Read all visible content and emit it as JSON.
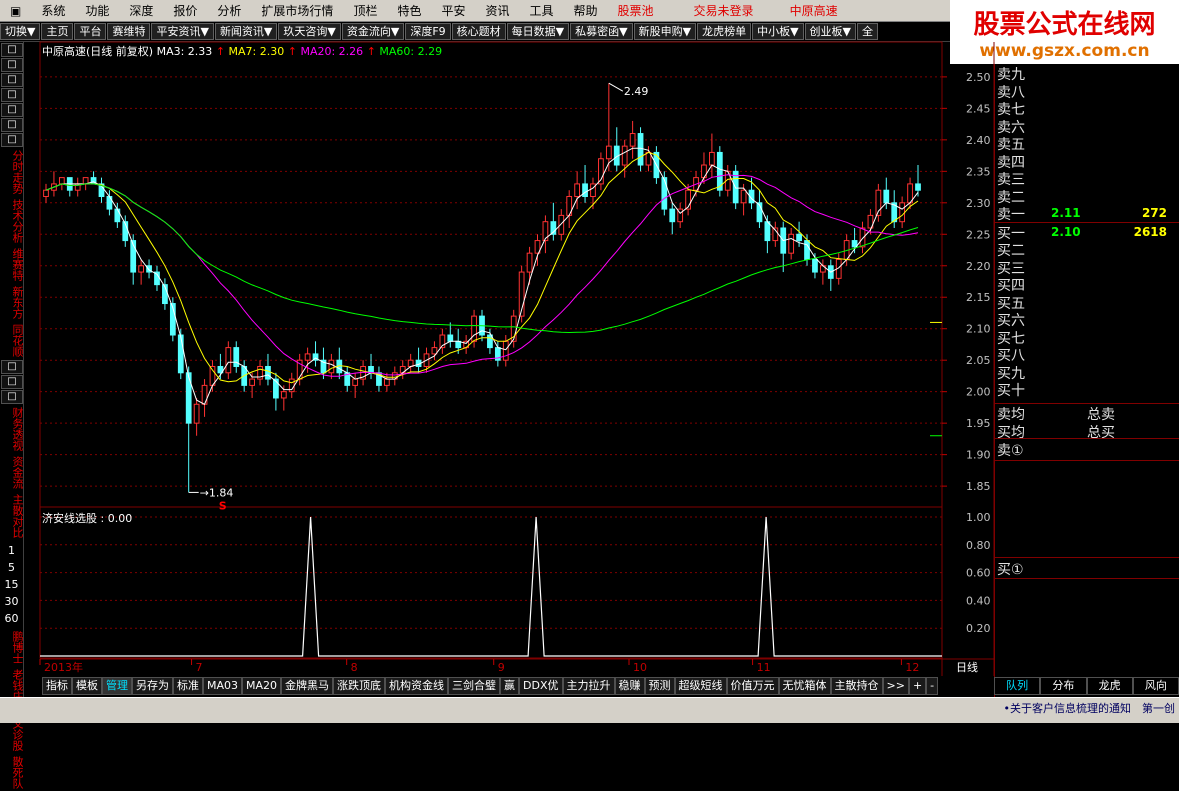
{
  "menu": [
    "系统",
    "功能",
    "深度",
    "报价",
    "分析",
    "扩展市场行情",
    "顶栏",
    "特色",
    "平安",
    "资讯",
    "工具",
    "帮助"
  ],
  "menu_highlight": "股票池",
  "login_status": "交易未登录",
  "stock_name": "中原高速",
  "banner": {
    "line1": "股票公式在线网",
    "line2": "www.gszx.com.cn"
  },
  "toolbar": [
    "切换▼",
    "主页",
    "平台",
    "赛维特",
    "平安资讯▼",
    "新闻资讯▼",
    "玖天咨询▼",
    "资金流向▼",
    "深度F9",
    "核心题材",
    "每日数据▼",
    "私募密函▼",
    "新股申购▼",
    "龙虎榜单",
    "中小板▼",
    "创业板▼",
    "全"
  ],
  "sidebar_text": [
    "分时走势",
    "技术分析",
    "维赛特",
    "新东方",
    "同花顺",
    "财务透视",
    "资金流",
    "主散对比",
    "鹏博士",
    "老钱庄",
    "牛叉诊股",
    "散死队"
  ],
  "sidebar_nums": [
    "1",
    "5",
    "15",
    "30",
    "60"
  ],
  "chart_title": {
    "name": "中原高速(日线 前复权)",
    "ma3": "MA3: 2.33",
    "ma7": "MA7: 2.30",
    "ma20": "MA20: 2.26",
    "ma60": "MA60: 2.29"
  },
  "sub_title": "济安线选股 : 0.00",
  "price_axis": [
    "2.50",
    "2.45",
    "2.40",
    "2.35",
    "2.30",
    "2.25",
    "2.20",
    "2.15",
    "2.10",
    "2.05",
    "2.00",
    "1.95",
    "1.90",
    "1.85"
  ],
  "sub_axis": [
    "1.00",
    "0.80",
    "0.60",
    "0.40",
    "0.20"
  ],
  "time_axis": [
    {
      "label": "2013年"
    },
    {
      "label": "7"
    },
    {
      "label": "8"
    },
    {
      "label": "9"
    },
    {
      "label": "10"
    },
    {
      "label": "11"
    },
    {
      "label": "12"
    }
  ],
  "period_label": "日线",
  "annotations": {
    "high": "2.49",
    "low": "1.84",
    "marker": "S"
  },
  "orderbook": {
    "sells": [
      "卖九",
      "卖八",
      "卖七",
      "卖六",
      "卖五",
      "卖四",
      "卖三",
      "卖二",
      "卖一"
    ],
    "sell1_price": "2.11",
    "sell1_vol": "272",
    "buys": [
      "买一",
      "买二",
      "买三",
      "买四",
      "买五",
      "买六",
      "买七",
      "买八",
      "买九",
      "买十"
    ],
    "buy1_price": "2.10",
    "buy1_vol": "2618",
    "avg_sell": "卖均",
    "avg_buy": "买均",
    "total_sell": "总卖",
    "total_buy": "总买",
    "sell_circle": "卖①",
    "buy_circle": "买①"
  },
  "bottom_tabs": [
    "指标",
    "模板",
    "管理",
    "另存为",
    "标准",
    "MA03",
    "MA20",
    "金牌黑马",
    "涨跌顶底",
    "机构资金线",
    "三剑合璧",
    "赢",
    "DDX优",
    "主力拉升",
    "稳赚",
    "预测",
    "超级短线",
    "价值万元",
    "无忧箱体",
    "主散持仓",
    ">>",
    "+",
    "-"
  ],
  "right_tabs": [
    "队列",
    "分布",
    "龙虎",
    "风向"
  ],
  "news": "•关于客户信息梳理的通知　第一创",
  "chart_data": {
    "type": "candlestick",
    "title": "中原高速(日线 前复权)",
    "ylim": [
      1.82,
      2.53
    ],
    "max_label": 2.49,
    "min_label": 1.84,
    "series": [
      {
        "name": "MA3",
        "color": "#ffffff",
        "last": 2.33
      },
      {
        "name": "MA7",
        "color": "#ffff00",
        "last": 2.3
      },
      {
        "name": "MA20",
        "color": "#ff00ff",
        "last": 2.26
      },
      {
        "name": "MA60",
        "color": "#00ff00",
        "last": 2.29
      }
    ],
    "ohlc": [
      [
        2.31,
        2.33,
        2.3,
        2.32
      ],
      [
        2.32,
        2.35,
        2.31,
        2.33
      ],
      [
        2.33,
        2.34,
        2.32,
        2.34
      ],
      [
        2.34,
        2.34,
        2.31,
        2.32
      ],
      [
        2.32,
        2.34,
        2.31,
        2.33
      ],
      [
        2.33,
        2.34,
        2.32,
        2.34
      ],
      [
        2.34,
        2.35,
        2.33,
        2.33
      ],
      [
        2.33,
        2.34,
        2.3,
        2.31
      ],
      [
        2.31,
        2.32,
        2.28,
        2.29
      ],
      [
        2.29,
        2.3,
        2.26,
        2.27
      ],
      [
        2.27,
        2.28,
        2.23,
        2.24
      ],
      [
        2.24,
        2.25,
        2.17,
        2.19
      ],
      [
        2.19,
        2.21,
        2.17,
        2.2
      ],
      [
        2.2,
        2.21,
        2.18,
        2.19
      ],
      [
        2.19,
        2.2,
        2.16,
        2.17
      ],
      [
        2.17,
        2.18,
        2.13,
        2.14
      ],
      [
        2.14,
        2.15,
        2.08,
        2.09
      ],
      [
        2.09,
        2.1,
        2.02,
        2.03
      ],
      [
        2.03,
        2.04,
        1.84,
        1.95
      ],
      [
        1.95,
        1.99,
        1.93,
        1.98
      ],
      [
        1.98,
        2.02,
        1.96,
        2.01
      ],
      [
        2.01,
        2.05,
        2.0,
        2.04
      ],
      [
        2.04,
        2.06,
        2.02,
        2.03
      ],
      [
        2.03,
        2.08,
        2.02,
        2.07
      ],
      [
        2.07,
        2.08,
        2.03,
        2.04
      ],
      [
        2.04,
        2.05,
        2.0,
        2.01
      ],
      [
        2.01,
        2.03,
        1.99,
        2.02
      ],
      [
        2.02,
        2.05,
        2.01,
        2.04
      ],
      [
        2.04,
        2.06,
        2.01,
        2.02
      ],
      [
        2.02,
        2.03,
        1.97,
        1.99
      ],
      [
        1.99,
        2.01,
        1.97,
        2.0
      ],
      [
        2.0,
        2.03,
        1.99,
        2.02
      ],
      [
        2.02,
        2.06,
        2.01,
        2.05
      ],
      [
        2.05,
        2.07,
        2.03,
        2.06
      ],
      [
        2.06,
        2.08,
        2.04,
        2.05
      ],
      [
        2.05,
        2.07,
        2.02,
        2.03
      ],
      [
        2.03,
        2.06,
        2.02,
        2.05
      ],
      [
        2.05,
        2.07,
        2.02,
        2.03
      ],
      [
        2.03,
        2.04,
        2.0,
        2.01
      ],
      [
        2.01,
        2.03,
        1.99,
        2.02
      ],
      [
        2.02,
        2.05,
        2.01,
        2.04
      ],
      [
        2.04,
        2.06,
        2.02,
        2.03
      ],
      [
        2.03,
        2.04,
        2.0,
        2.01
      ],
      [
        2.01,
        2.03,
        2.0,
        2.02
      ],
      [
        2.02,
        2.04,
        2.01,
        2.03
      ],
      [
        2.03,
        2.05,
        2.02,
        2.04
      ],
      [
        2.04,
        2.06,
        2.03,
        2.05
      ],
      [
        2.05,
        2.07,
        2.03,
        2.04
      ],
      [
        2.04,
        2.07,
        2.03,
        2.06
      ],
      [
        2.06,
        2.08,
        2.05,
        2.07
      ],
      [
        2.07,
        2.1,
        2.06,
        2.09
      ],
      [
        2.09,
        2.11,
        2.07,
        2.08
      ],
      [
        2.08,
        2.1,
        2.06,
        2.07
      ],
      [
        2.07,
        2.09,
        2.06,
        2.08
      ],
      [
        2.08,
        2.13,
        2.07,
        2.12
      ],
      [
        2.12,
        2.13,
        2.08,
        2.09
      ],
      [
        2.09,
        2.1,
        2.06,
        2.07
      ],
      [
        2.07,
        2.08,
        2.04,
        2.05
      ],
      [
        2.05,
        2.09,
        2.04,
        2.08
      ],
      [
        2.08,
        2.13,
        2.07,
        2.12
      ],
      [
        2.12,
        2.2,
        2.11,
        2.19
      ],
      [
        2.19,
        2.23,
        2.17,
        2.22
      ],
      [
        2.22,
        2.25,
        2.2,
        2.24
      ],
      [
        2.24,
        2.28,
        2.22,
        2.27
      ],
      [
        2.27,
        2.3,
        2.24,
        2.25
      ],
      [
        2.25,
        2.29,
        2.24,
        2.28
      ],
      [
        2.28,
        2.32,
        2.26,
        2.31
      ],
      [
        2.31,
        2.35,
        2.29,
        2.33
      ],
      [
        2.33,
        2.36,
        2.3,
        2.31
      ],
      [
        2.31,
        2.34,
        2.29,
        2.33
      ],
      [
        2.33,
        2.38,
        2.32,
        2.37
      ],
      [
        2.37,
        2.49,
        2.35,
        2.39
      ],
      [
        2.39,
        2.42,
        2.35,
        2.36
      ],
      [
        2.36,
        2.4,
        2.34,
        2.39
      ],
      [
        2.39,
        2.43,
        2.37,
        2.41
      ],
      [
        2.41,
        2.42,
        2.35,
        2.36
      ],
      [
        2.36,
        2.39,
        2.35,
        2.38
      ],
      [
        2.38,
        2.39,
        2.33,
        2.34
      ],
      [
        2.34,
        2.35,
        2.28,
        2.29
      ],
      [
        2.29,
        2.3,
        2.25,
        2.27
      ],
      [
        2.27,
        2.3,
        2.26,
        2.29
      ],
      [
        2.29,
        2.33,
        2.28,
        2.32
      ],
      [
        2.32,
        2.35,
        2.31,
        2.34
      ],
      [
        2.34,
        2.38,
        2.33,
        2.36
      ],
      [
        2.36,
        2.41,
        2.34,
        2.38
      ],
      [
        2.38,
        2.39,
        2.31,
        2.32
      ],
      [
        2.32,
        2.36,
        2.31,
        2.35
      ],
      [
        2.35,
        2.36,
        2.29,
        2.3
      ],
      [
        2.3,
        2.33,
        2.28,
        2.32
      ],
      [
        2.32,
        2.34,
        2.29,
        2.3
      ],
      [
        2.3,
        2.32,
        2.26,
        2.27
      ],
      [
        2.27,
        2.28,
        2.22,
        2.24
      ],
      [
        2.24,
        2.27,
        2.23,
        2.26
      ],
      [
        2.26,
        2.27,
        2.19,
        2.22
      ],
      [
        2.22,
        2.26,
        2.21,
        2.25
      ],
      [
        2.25,
        2.27,
        2.23,
        2.24
      ],
      [
        2.24,
        2.25,
        2.2,
        2.21
      ],
      [
        2.21,
        2.22,
        2.18,
        2.19
      ],
      [
        2.19,
        2.21,
        2.17,
        2.2
      ],
      [
        2.2,
        2.21,
        2.16,
        2.18
      ],
      [
        2.18,
        2.22,
        2.17,
        2.21
      ],
      [
        2.21,
        2.25,
        2.2,
        2.24
      ],
      [
        2.24,
        2.26,
        2.22,
        2.23
      ],
      [
        2.23,
        2.27,
        2.22,
        2.26
      ],
      [
        2.26,
        2.29,
        2.25,
        2.28
      ],
      [
        2.28,
        2.33,
        2.27,
        2.32
      ],
      [
        2.32,
        2.34,
        2.29,
        2.3
      ],
      [
        2.3,
        2.32,
        2.26,
        2.27
      ],
      [
        2.27,
        2.31,
        2.26,
        2.3
      ],
      [
        2.3,
        2.34,
        2.29,
        2.33
      ],
      [
        2.33,
        2.36,
        2.31,
        2.32
      ]
    ],
    "signal_peaks": [
      0.3,
      0.55,
      0.805
    ]
  }
}
